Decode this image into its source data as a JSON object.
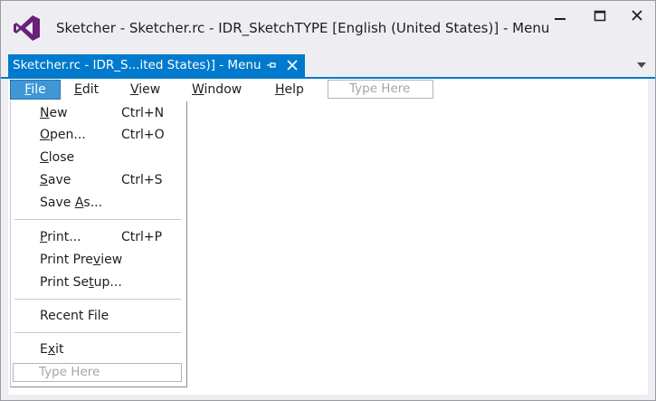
{
  "window": {
    "title": "Sketcher - Sketcher.rc - IDR_SketchTYPE [English (United States)] - Menu"
  },
  "tab": {
    "label": "Sketcher.rc - IDR_S...ited States)] - Menu"
  },
  "menubar": {
    "items": [
      {
        "label": "File",
        "mnemonic": "F",
        "rest": "ile"
      },
      {
        "label": "Edit",
        "mnemonic": "E",
        "rest": "dit"
      },
      {
        "label": "View",
        "mnemonic": "V",
        "rest": "iew"
      },
      {
        "label": "Window",
        "mnemonic": "W",
        "rest": "indow"
      },
      {
        "label": "Help",
        "mnemonic": "H",
        "rest": "elp"
      }
    ],
    "type_here": "Type Here"
  },
  "file_menu": {
    "items": [
      {
        "pre": "",
        "mn": "N",
        "post": "ew",
        "shortcut": "Ctrl+N"
      },
      {
        "pre": "",
        "mn": "O",
        "post": "pen...",
        "shortcut": "Ctrl+O"
      },
      {
        "pre": "",
        "mn": "C",
        "post": "lose",
        "shortcut": ""
      },
      {
        "pre": "",
        "mn": "S",
        "post": "ave",
        "shortcut": "Ctrl+S"
      },
      {
        "pre": "Save ",
        "mn": "A",
        "post": "s...",
        "shortcut": ""
      },
      {
        "pre": "",
        "mn": "P",
        "post": "rint...",
        "shortcut": "Ctrl+P"
      },
      {
        "pre": "Print Pre",
        "mn": "v",
        "post": "iew",
        "shortcut": ""
      },
      {
        "pre": "Print Se",
        "mn": "t",
        "post": "up...",
        "shortcut": ""
      },
      {
        "pre": "Recent File",
        "mn": "",
        "post": "",
        "shortcut": ""
      },
      {
        "pre": "E",
        "mn": "x",
        "post": "it",
        "shortcut": ""
      }
    ],
    "type_here": "Type Here"
  },
  "colors": {
    "accent": "#007acc",
    "selected_menu": "#3f97d6",
    "vs_logo": "#68217a"
  },
  "icons": {
    "logo": "visual-studio-logo",
    "minimize": "minimize-icon",
    "maximize": "maximize-icon",
    "close": "close-icon",
    "pin": "pin-icon",
    "tab_close": "close-icon",
    "dropdown": "chevron-down-icon"
  }
}
